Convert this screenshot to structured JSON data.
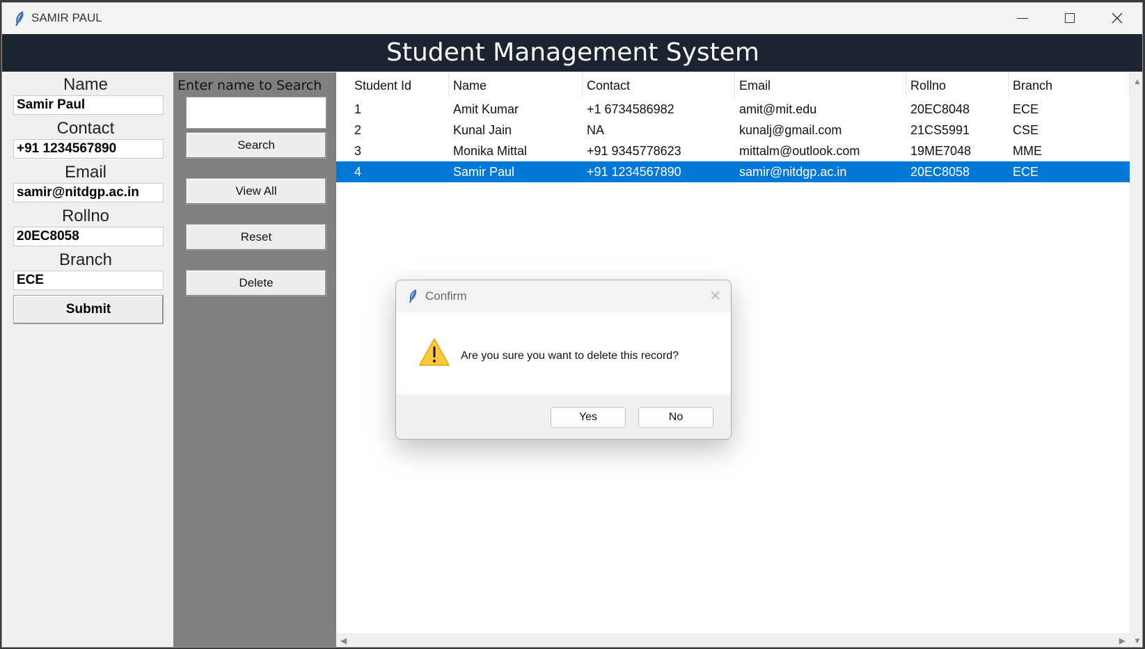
{
  "window": {
    "title": "SAMIR PAUL"
  },
  "header": {
    "title": "Student Management System"
  },
  "form": {
    "name_label": "Name",
    "name_value": "Samir Paul",
    "contact_label": "Contact",
    "contact_value": "+91 1234567890",
    "email_label": "Email",
    "email_value": "samir@nitdgp.ac.in",
    "rollno_label": "Rollno",
    "rollno_value": "20EC8058",
    "branch_label": "Branch",
    "branch_value": "ECE",
    "submit_label": "Submit"
  },
  "search": {
    "label": "Enter name to Search",
    "value": "",
    "search_label": "Search",
    "view_all_label": "View All",
    "reset_label": "Reset",
    "delete_label": "Delete"
  },
  "table": {
    "columns": [
      "Student Id",
      "Name",
      "Contact",
      "Email",
      "Rollno",
      "Branch"
    ],
    "rows": [
      [
        "1",
        "Amit Kumar",
        "+1 6734586982",
        "amit@mit.edu",
        "20EC8048",
        "ECE"
      ],
      [
        "2",
        "Kunal Jain",
        "NA",
        "kunalj@gmail.com",
        "21CS5991",
        "CSE"
      ],
      [
        "3",
        "Monika Mittal",
        "+91 9345778623",
        "mittalm@outlook.com",
        "19ME7048",
        "MME"
      ],
      [
        "4",
        "Samir Paul",
        "+91 1234567890",
        "samir@nitdgp.ac.in",
        "20EC8058",
        "ECE"
      ]
    ],
    "selected_row_index": 3
  },
  "dialog": {
    "title": "Confirm",
    "message": "Are you sure you want to delete this record?",
    "yes_label": "Yes",
    "no_label": "No"
  },
  "colors": {
    "header_bg": "#1b2430",
    "selection": "#0078d7",
    "search_panel": "#808080",
    "warning": "#ffc83d"
  },
  "icons": [
    "feather-icon",
    "minimize-icon",
    "maximize-icon",
    "close-icon",
    "warning-icon"
  ]
}
